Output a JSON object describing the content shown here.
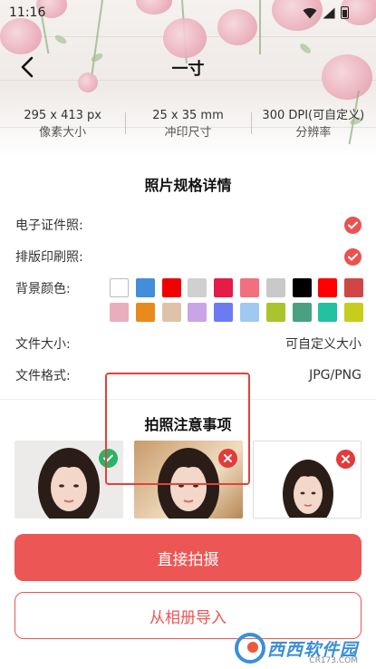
{
  "status_bar": {
    "time": "11:16"
  },
  "header": {
    "title": "一寸"
  },
  "specs": [
    {
      "value": "295 x 413 px",
      "label": "像素大小"
    },
    {
      "value": "25 x 35 mm",
      "label": "冲印尺寸"
    },
    {
      "value": "300 DPI(可自定义)",
      "label": "分辨率"
    }
  ],
  "details": {
    "title": "照片规格详情",
    "electronic_label": "电子证件照:",
    "print_label": "排版印刷照:",
    "bg_label": "背景颜色:",
    "size_label": "文件大小:",
    "size_value": "可自定义大小",
    "format_label": "文件格式:",
    "format_value": "JPG/PNG",
    "colors": [
      "#ffffff",
      "#438edb",
      "#f00000",
      "#d0d0d0",
      "#e51b48",
      "#f0707d",
      "#c9c9c9",
      "#000000",
      "#ff0000",
      "#d04646",
      "#e8aebd",
      "#e88a1c",
      "#dfc3a9",
      "#c9a5e8",
      "#6b7cf2",
      "#9ec9f2",
      "#a9c42d",
      "#4aa080",
      "#23c1a1",
      "#c7cd1c"
    ]
  },
  "notes": {
    "title": "拍照注意事项"
  },
  "actions": {
    "shoot_label": "直接拍摄",
    "album_label": "从相册导入"
  },
  "watermark": {
    "text": "西西软件园",
    "sub": "CR173.COM"
  }
}
